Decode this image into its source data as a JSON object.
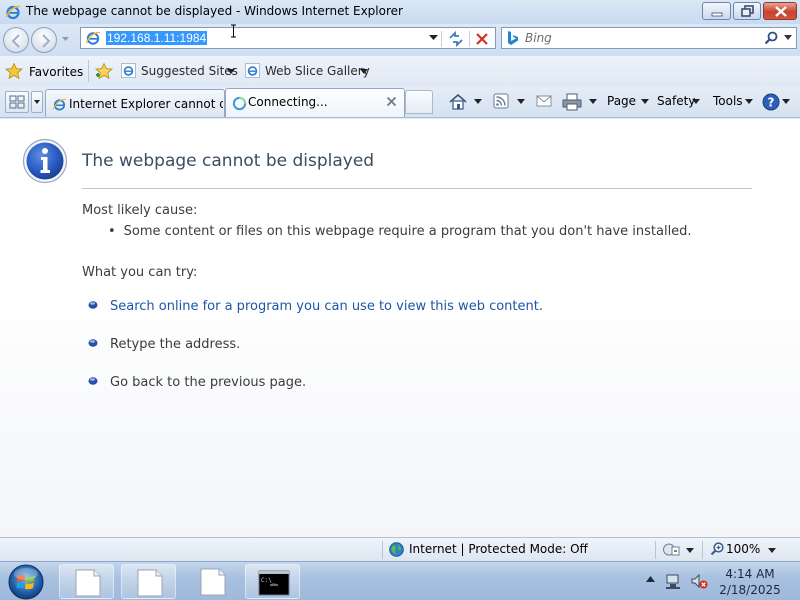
{
  "window": {
    "title": "The webpage cannot be displayed - Windows Internet Explorer"
  },
  "address_bar": {
    "url": "192.168.1.11:1984"
  },
  "search": {
    "placeholder": "Bing"
  },
  "favorites_bar": {
    "favorites_label": "Favorites",
    "links": [
      {
        "label": "Suggested Sites"
      },
      {
        "label": "Web Slice Gallery"
      }
    ]
  },
  "tabs": [
    {
      "label": "Internet Explorer cannot di...",
      "state": "inactive"
    },
    {
      "label": "Connecting...",
      "state": "active"
    }
  ],
  "command_bar": {
    "page_label": "Page",
    "safety_label": "Safety",
    "tools_label": "Tools"
  },
  "content": {
    "title": "The webpage cannot be displayed",
    "cause_heading": "Most likely cause:",
    "cause_items": [
      "Some content or files on this webpage require a program that you don't have installed."
    ],
    "try_heading": "What you can try:",
    "try_items": [
      {
        "text": "Search online for a program you can use to view this web content.",
        "is_link": true
      },
      {
        "text": "Retype the address.",
        "is_link": false
      },
      {
        "text": "Go back to the previous page.",
        "is_link": false
      }
    ]
  },
  "status_bar": {
    "zone_text": "Internet | Protected Mode: Off",
    "zoom": "100%"
  },
  "taskbar": {
    "buttons": [
      "document",
      "document",
      "document",
      "command-prompt"
    ],
    "time": "4:14 AM",
    "date": "2/18/2025"
  },
  "colors": {
    "link": "#1f56a6",
    "selection": "#3399ff",
    "title_text": "#3a4d63",
    "close_button": "#c7422c"
  }
}
